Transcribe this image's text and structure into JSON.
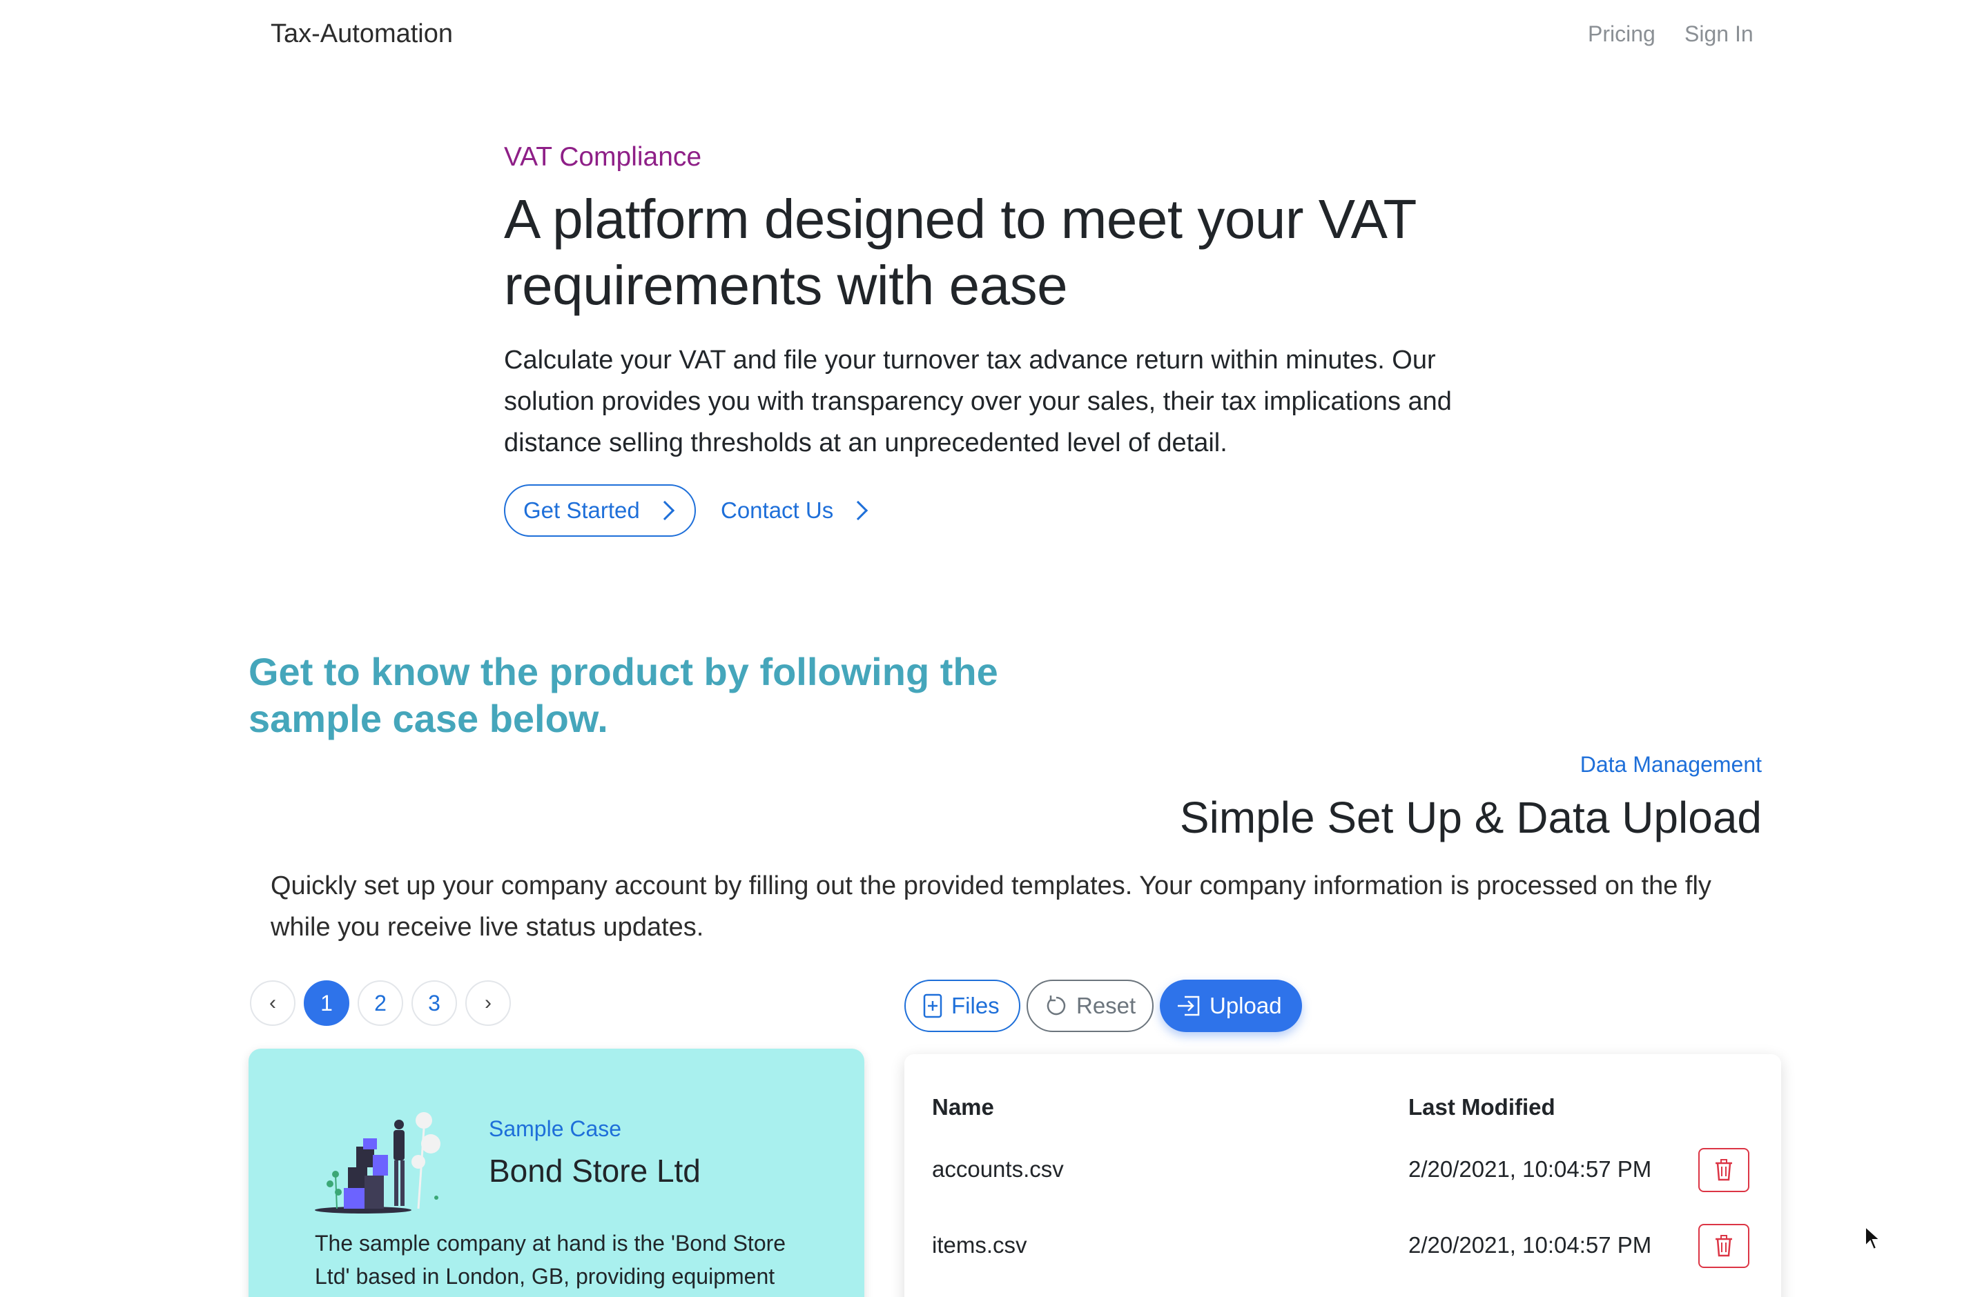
{
  "nav": {
    "brand": "Tax-Automation",
    "links": [
      "Pricing",
      "Sign In"
    ]
  },
  "hero": {
    "eyebrow": "VAT Compliance",
    "title": "A platform designed to meet your VAT requirements with ease",
    "description": "Calculate your VAT and file your turnover tax advance return within minutes. Our solution provides you with transparency over your sales, their tax implications and distance selling thresholds at an unprecedented level of detail.",
    "primary_button": "Get Started",
    "secondary_button": "Contact Us"
  },
  "sample_section": {
    "heading": "Get to know the product by following the sample case below.",
    "eyebrow": "Data Management",
    "title": "Simple Set Up & Data Upload",
    "description": "Quickly set up your company account by filling out the provided templates. Your company information is processed on the fly while you receive live status updates."
  },
  "pagination": {
    "prev": "‹",
    "pages": [
      "1",
      "2",
      "3"
    ],
    "active_page": "1",
    "next": "›"
  },
  "actions": {
    "files": "Files",
    "reset": "Reset",
    "upload": "Upload"
  },
  "case_card": {
    "eyebrow": "Sample Case",
    "title": "Bond Store Ltd",
    "description": "The sample company at hand is the 'Bond Store Ltd' based in London, GB, providing equipment"
  },
  "files_table": {
    "columns": [
      "Name",
      "Last Modified"
    ],
    "rows": [
      {
        "name": "accounts.csv",
        "modified": "2/20/2021, 10:04:57 PM"
      },
      {
        "name": "items.csv",
        "modified": "2/20/2021, 10:04:57 PM"
      }
    ]
  },
  "colors": {
    "primary": "#2e73ea",
    "eyebrow_purple": "#8e1f87",
    "section_teal": "#45a6bb",
    "card_bg": "#a9f0ee",
    "danger": "#dc3545"
  },
  "icons": {
    "files": "file-plus-icon",
    "reset": "reset-icon",
    "upload": "upload-icon",
    "delete": "trash-icon"
  }
}
